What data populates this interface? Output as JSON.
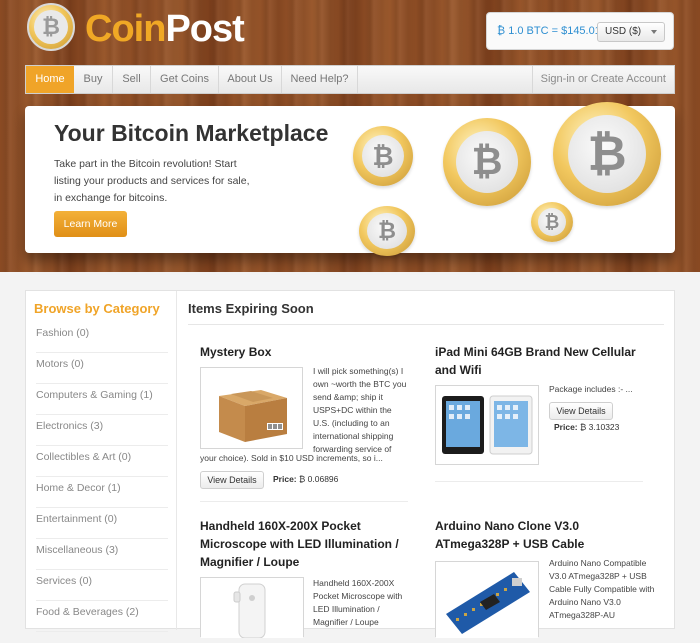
{
  "brand": {
    "name_part1": "Coin",
    "name_part2": "Post",
    "logo_symbol": "₿"
  },
  "rate": {
    "text": "₿ 1.0 BTC = $145.01",
    "currency": "USD ($)"
  },
  "nav": {
    "items": [
      "Home",
      "Buy",
      "Sell",
      "Get Coins",
      "About Us",
      "Need Help?"
    ],
    "active": "Home",
    "account_link": "Sign-in or Create Account"
  },
  "hero": {
    "title": "Your Bitcoin Marketplace",
    "text": "Take part in the Bitcoin revolution! Start listing your products and services for sale, in exchange for bitcoins.",
    "button": "Learn More",
    "coin_symbol": "₿"
  },
  "sidebar": {
    "title": "Browse by Category",
    "categories": [
      "Fashion (0)",
      "Motors (0)",
      "Computers & Gaming (1)",
      "Electronics (3)",
      "Collectibles & Art (0)",
      "Home & Decor (1)",
      "Entertainment (0)",
      "Miscellaneous (3)",
      "Services (0)",
      "Food & Beverages (2)"
    ]
  },
  "main": {
    "title": "Items Expiring Soon",
    "items": [
      {
        "title": "Mystery Box",
        "desc_side": "I will pick something(s) I own ~worth the BTC you send &amp; ship it USPS+DC within the U.S. (including to an international shipping forwarding service of",
        "desc_full": "your choice). Sold in $10 USD increments, so i...",
        "button": "View Details",
        "price_label": "Price:",
        "price": "₿ 0.06896",
        "image": "cardboard-box"
      },
      {
        "title": "iPad Mini 64GB Brand New Cellular and Wifi",
        "desc_side": "Package includes :- ...",
        "button": "View Details",
        "price_label": "Price:",
        "price": "₿ 3.10323",
        "image": "ipad-mini"
      },
      {
        "title": "Handheld 160X-200X Pocket Microscope with LED Illumination / Magnifier / Loupe",
        "desc_side": "Handheld 160X-200X Pocket Microscope with LED Illumination / Magnifier / Loupe",
        "image": "microscope"
      },
      {
        "title": "Arduino Nano Clone V3.0 ATmega328P + USB Cable",
        "desc_side": "Arduino Nano Compatible V3.0 ATmega328P + USB Cable Fully Compatible with Arduino Nano V3.0 ATmega328P-AU",
        "image": "arduino-board"
      }
    ]
  },
  "colors": {
    "accent": "#f0a428",
    "link": "#2e8fd1",
    "wood": "#8a4a23"
  }
}
